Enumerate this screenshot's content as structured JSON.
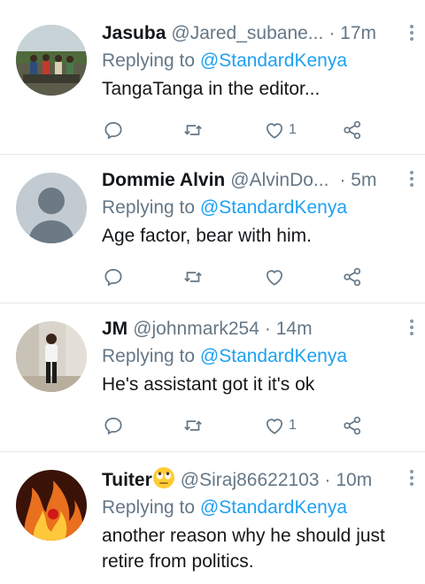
{
  "tweets": [
    {
      "name": "Jasuba",
      "handle": "@Jared_subane...",
      "time": "· 17m",
      "replying_prefix": "Replying to ",
      "replying_to": "@StandardKenya",
      "text": "TangaTanga in the editor...",
      "likes": "1",
      "avatar": "group-photo"
    },
    {
      "name": "Dommie Alvin",
      "handle": "@AlvinDo...",
      "time": "· 5m",
      "replying_prefix": "Replying to ",
      "replying_to": "@StandardKenya",
      "text": "Age factor, bear with him.",
      "likes": "",
      "avatar": "default-profile"
    },
    {
      "name": "JM",
      "handle": "@johnmark254",
      "time": "· 14m",
      "replying_prefix": "Replying to ",
      "replying_to": "@StandardKenya",
      "text": "He's assistant  got it it's ok",
      "likes": "1",
      "avatar": "person-standing"
    },
    {
      "name": "Tuiter",
      "name_emoji": "face-with-rolling-eyes-emoji",
      "handle": "@Siraj86622103",
      "time": "· 10m",
      "replying_prefix": "Replying to ",
      "replying_to": "@StandardKenya",
      "text": "another reason why he should just retire from politics.",
      "likes": "",
      "avatar": "fire-image"
    }
  ],
  "icons": {
    "reply": "reply-icon",
    "retweet": "retweet-icon",
    "like": "heart-icon",
    "share": "share-icon",
    "more": "more-vertical-icon"
  },
  "colors": {
    "accent": "#1da1f2",
    "secondary_text": "#657786",
    "primary_text": "#14171a",
    "divider": "#e1e8ed"
  }
}
